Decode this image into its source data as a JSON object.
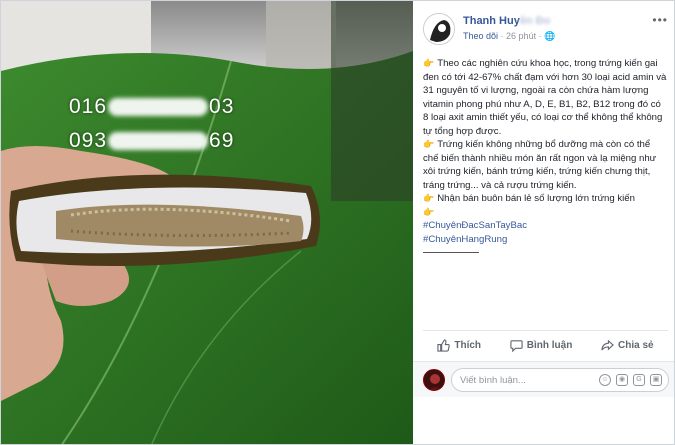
{
  "photo": {
    "phone_1_start": "016",
    "phone_1_end": "03",
    "phone_2_start": "093",
    "phone_2_end": "69"
  },
  "post": {
    "author": "Thanh Huy",
    "author_faded": "ền Đo",
    "follow": "Theo dõi",
    "time": "· 26 phút ·",
    "more": "•••",
    "paragraph_1": "Theo các nghiên cứu khoa học, trong trứng kiến gai đen có tới 42-67% chất đạm với hơn 30 loại acid amin và 31 nguyên tố vi lượng, ngoài ra còn chứa hàm lượng vitamin phong phú như A, D, E, B1, B2, B12 trong đó có 8 loại axit amin thiết yếu, có loại cơ thể không thể không tự tổng hợp được.",
    "paragraph_2": "Trứng kiến không những bổ dưỡng mà còn có thể chế biến thành nhiều món ăn rất ngon và lạ miệng như xôi trứng kiến, bánh trứng kiến, trứng kiến chưng thịt, tráng trứng... và cả rượu trứng kiến.",
    "paragraph_3": "Nhận bán buôn bán lẻ số lượng lớn trứng kiến",
    "hashtag_1": "#ChuyênĐacSanTayBac",
    "hashtag_2": "#ChuyênHangRung",
    "emoji_point": "👉"
  },
  "actions": {
    "like": "Thích",
    "comment": "Bình luận",
    "share": "Chia sẻ"
  },
  "comment_box": {
    "placeholder": "Viết bình luận..."
  },
  "colors": {
    "link": "#365899",
    "meta": "#90949c"
  }
}
